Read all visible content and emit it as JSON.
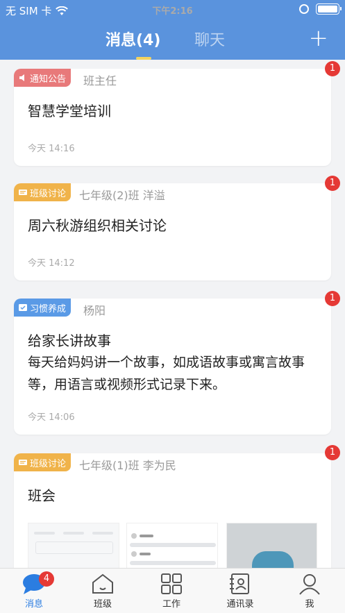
{
  "status": {
    "carrier": "无 SIM 卡",
    "time": "下午2:16"
  },
  "header": {
    "tab_messages": "消息(4)",
    "tab_chat": "聊天",
    "add_label": "+"
  },
  "cards": [
    {
      "tag": "通知公告",
      "tag_color": "#e8797a",
      "source": "班主任",
      "title": "智慧学堂培训",
      "time": "今天 14:16",
      "unread": "1"
    },
    {
      "tag": "班级讨论",
      "tag_color": "#f0b34a",
      "source": "七年级(2)班  洋溢",
      "title": "周六秋游组织相关讨论",
      "time": "今天 14:12",
      "unread": "1"
    },
    {
      "tag": "习惯养成",
      "tag_color": "#5a9ae6",
      "source": "杨阳",
      "title": "给家长讲故事",
      "body": "每天给妈妈讲一个故事，如成语故事或寓言故事等，用语言或视频形式记录下来。",
      "time": "今天 14:06",
      "unread": "1"
    },
    {
      "tag": "班级讨论",
      "tag_color": "#f0b34a",
      "source": "七年级(1)班  李为民",
      "title": "班会",
      "unread": "1"
    }
  ],
  "tabbar": {
    "items": [
      {
        "label": "消息",
        "icon": "chat-bubble-icon",
        "badge": "4"
      },
      {
        "label": "班级",
        "icon": "house-icon"
      },
      {
        "label": "工作",
        "icon": "grid-icon"
      },
      {
        "label": "通讯录",
        "icon": "contacts-book-icon"
      },
      {
        "label": "我",
        "icon": "person-icon"
      }
    ]
  },
  "colors": {
    "header": "#5a93dd",
    "badge": "#e53935",
    "active": "#2b7de1"
  }
}
